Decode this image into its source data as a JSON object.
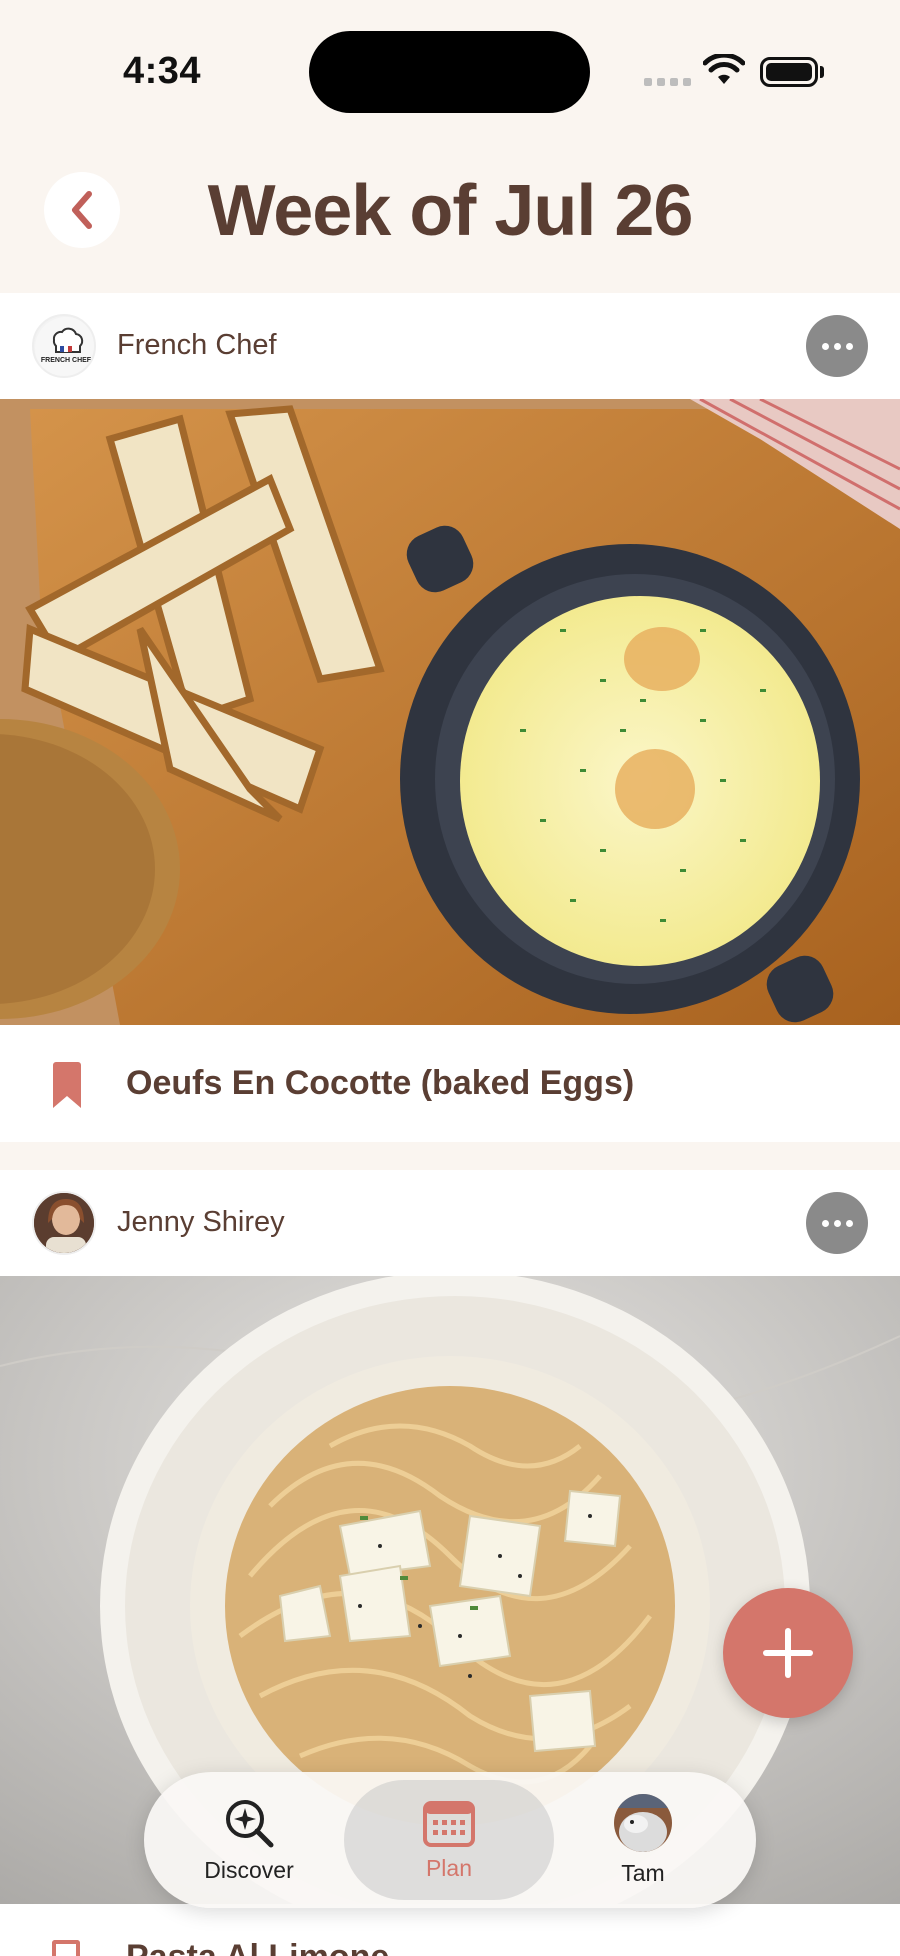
{
  "status_bar": {
    "time": "4:34"
  },
  "header": {
    "back_icon": "chevron-left-icon",
    "title": "Week of Jul 26"
  },
  "recipes": [
    {
      "author": "French Chef",
      "author_badge": "FRENCH CHEF",
      "image": "baked eggs in cast iron pot with bread on wooden board",
      "title": "Oeufs En Cocotte (baked Eggs)",
      "bookmarked": true
    },
    {
      "author": "Jenny Shirey",
      "image": "spaghetti with parmesan shavings on white plate",
      "title": "Pasta Al Limone",
      "bookmarked": false
    }
  ],
  "fab": {
    "icon": "plus-icon"
  },
  "tab_bar": {
    "tabs": [
      {
        "label": "Discover",
        "icon": "discover-search-icon",
        "active": false
      },
      {
        "label": "Plan",
        "icon": "calendar-icon",
        "active": true
      },
      {
        "label": "Tam",
        "icon": "avatar",
        "active": false
      }
    ]
  },
  "colors": {
    "accent": "#d4766b",
    "text": "#5a3e33",
    "background": "#faf5f0"
  }
}
